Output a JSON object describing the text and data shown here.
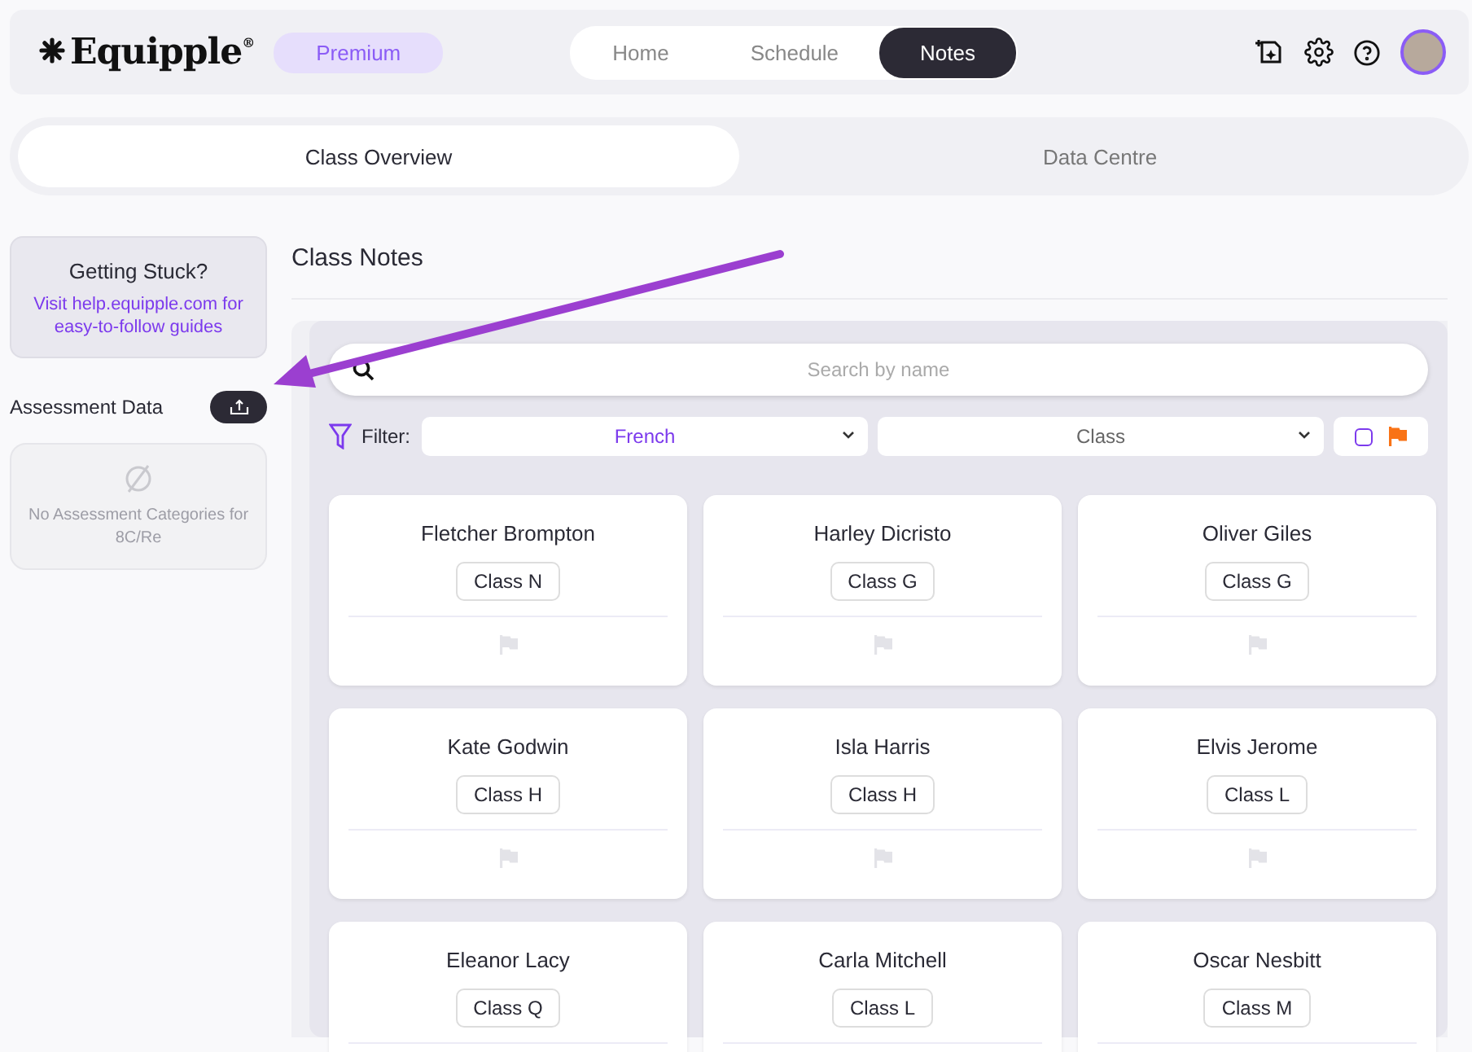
{
  "header": {
    "logo": "Equipple",
    "logo_mark": "®",
    "plan_badge": "Premium",
    "nav": [
      {
        "label": "Home",
        "selected": false
      },
      {
        "label": "Schedule",
        "selected": false
      },
      {
        "label": "Notes",
        "selected": true
      }
    ]
  },
  "view_tabs": [
    {
      "label": "Class Overview",
      "selected": true
    },
    {
      "label": "Data Centre",
      "selected": false
    }
  ],
  "sidebar": {
    "help_card": {
      "title": "Getting Stuck?",
      "link": "Visit help.equipple.com for easy-to-follow guides"
    },
    "assessment_label": "Assessment Data",
    "empty_state": "No Assessment Categories for 8C/Re"
  },
  "main": {
    "title": "Class Notes",
    "search": {
      "placeholder": "Search by name"
    },
    "filter_label": "Filter:",
    "subject_select": {
      "value": "French"
    },
    "class_select": {
      "placeholder": "Class"
    },
    "flag_filter": {
      "checked": false
    },
    "students": [
      {
        "name": "Fletcher Brompton",
        "class": "Class N",
        "flagged": false
      },
      {
        "name": "Harley Dicristo",
        "class": "Class G",
        "flagged": false
      },
      {
        "name": "Oliver Giles",
        "class": "Class G",
        "flagged": false
      },
      {
        "name": "Kate Godwin",
        "class": "Class H",
        "flagged": false
      },
      {
        "name": "Isla Harris",
        "class": "Class H",
        "flagged": false
      },
      {
        "name": "Elvis Jerome",
        "class": "Class L",
        "flagged": false
      },
      {
        "name": "Eleanor Lacy",
        "class": "Class Q"
      },
      {
        "name": "Carla Mitchell",
        "class": "Class L"
      },
      {
        "name": "Oscar Nesbitt",
        "class": "Class M"
      }
    ]
  }
}
